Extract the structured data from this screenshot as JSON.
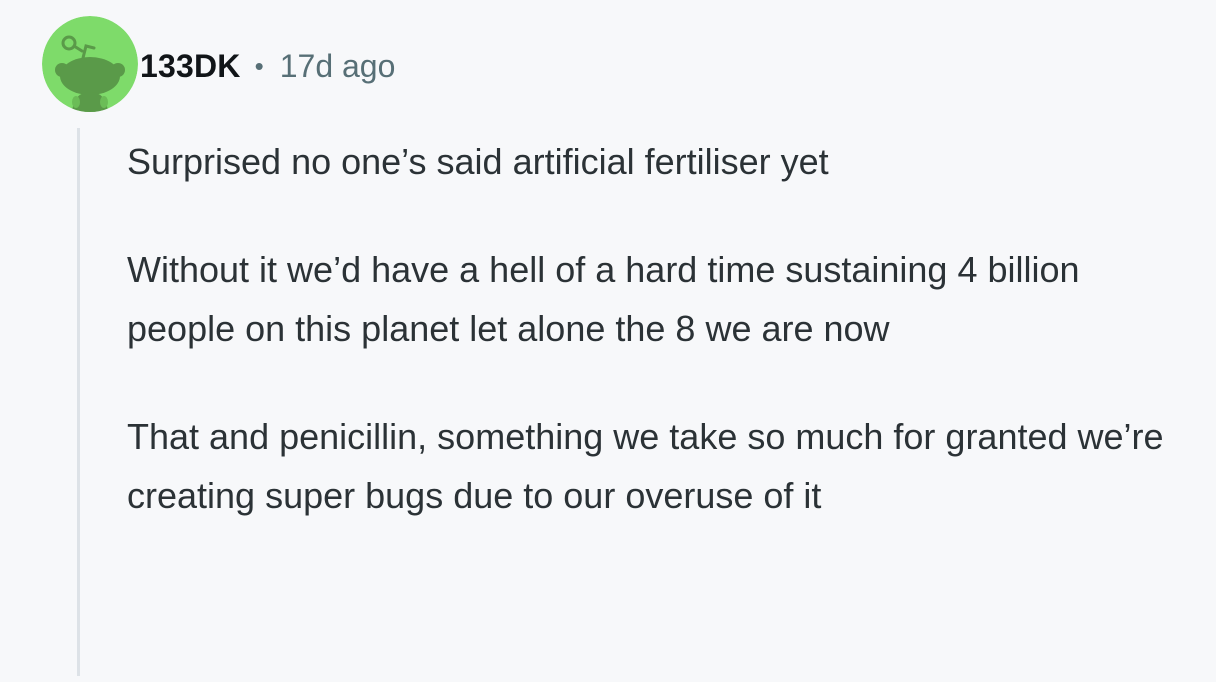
{
  "comment": {
    "username": "133DK",
    "separator": "•",
    "timestamp": "17d ago",
    "avatar_icon": "reddit-snoo-avatar",
    "avatar_color": "#7edb6a",
    "paragraphs": [
      "Surprised no one’s said artificial fertiliser yet",
      "Without it we’d have a hell of a hard time sustaining 4 billion people on this planet let alone the 8 we are now",
      "That and penicillin, something we take so much for granted we’re creating super bugs due to our overuse of it"
    ]
  }
}
